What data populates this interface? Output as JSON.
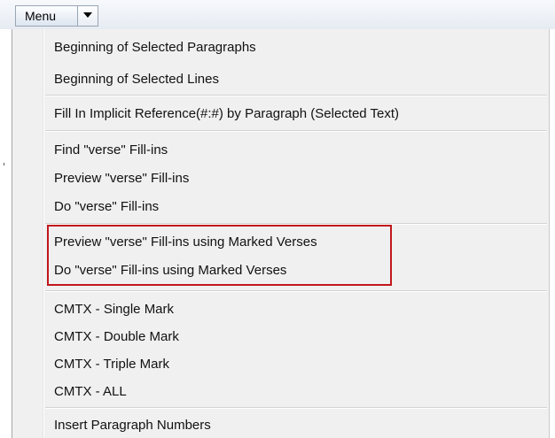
{
  "toolbar": {
    "menu_label": "Menu",
    "dropdown_icon": "triangle-down-icon"
  },
  "menu": {
    "groups": [
      [
        "Beginning of Selected Paragraphs",
        "Beginning of Selected Lines"
      ],
      [
        "Fill In Implicit Reference(#:#) by Paragraph (Selected Text)"
      ],
      [
        "Find \"verse\" Fill-ins",
        "Preview \"verse\" Fill-ins",
        "Do \"verse\" Fill-ins"
      ],
      [
        "Preview \"verse\" Fill-ins using Marked Verses",
        "Do \"verse\" Fill-ins using Marked Verses"
      ],
      [
        "CMTX - Single Mark",
        "CMTX - Double Mark",
        "CMTX - Triple Mark",
        "CMTX - ALL"
      ],
      [
        "Insert Paragraph Numbers"
      ]
    ]
  },
  "colors": {
    "highlight_border": "#c0171c",
    "menu_background": "#f0f0f0"
  }
}
